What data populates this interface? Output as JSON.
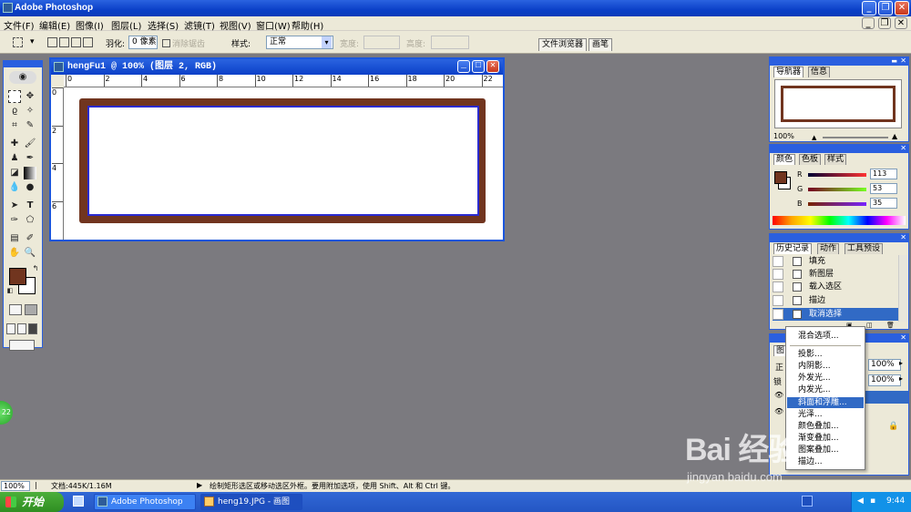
{
  "app": {
    "title": "Adobe Photoshop"
  },
  "menu": [
    "文件(F)",
    "编辑(E)",
    "图像(I)",
    "图层(L)",
    "选择(S)",
    "滤镜(T)",
    "视图(V)",
    "窗口(W)",
    "帮助(H)"
  ],
  "options": {
    "feather_label": "羽化:",
    "feather_value": "0 像素",
    "antialias_label": "消除锯齿",
    "style_label": "样式:",
    "style_value": "正常",
    "width_label": "宽度:",
    "height_label": "高度:",
    "dock_tabs": [
      "文件浏览器",
      "画笔"
    ]
  },
  "document": {
    "title": "hengFu1 @ 100% (图层 2, RGB)",
    "ruler_h": [
      "0",
      "2",
      "4",
      "6",
      "8",
      "10",
      "12",
      "14",
      "16",
      "18",
      "20",
      "22"
    ],
    "ruler_v": [
      "0",
      "2",
      "4",
      "6"
    ]
  },
  "navigator": {
    "tabs": [
      "导航器",
      "信息"
    ],
    "zoom": "100%"
  },
  "color": {
    "tabs": [
      "颜色",
      "色板",
      "样式"
    ],
    "fg_hex": "#71351f",
    "r_label": "R",
    "r": "113",
    "g_label": "G",
    "g": "53",
    "b_label": "B",
    "b": "35"
  },
  "history": {
    "tabs": [
      "历史记录",
      "动作",
      "工具预设"
    ],
    "items": [
      "填充",
      "新图层",
      "载入选区",
      "描边",
      "取消选择"
    ]
  },
  "layers": {
    "tab": "图",
    "mode_visible": "正",
    "opacity": "100%",
    "fill": "100%",
    "lock_visible": "锁"
  },
  "context_menu": {
    "items": [
      "混合选项...",
      "投影...",
      "内阴影...",
      "外发光...",
      "内发光...",
      "斜面和浮雕...",
      "光泽...",
      "颜色叠加...",
      "渐变叠加...",
      "图案叠加...",
      "描边..."
    ],
    "highlighted": "斜面和浮雕..."
  },
  "status": {
    "zoom": "100%",
    "doc_info": "文档:445K/1.16M",
    "hint": "绘制矩形选区或移动选区外框。要用附加选项，使用 Shift、Alt 和 Ctrl 键。"
  },
  "taskbar": {
    "start": "开始",
    "buttons": [
      "Adobe Photoshop",
      "heng19.JPG - 画图"
    ],
    "clock": "9:44"
  },
  "watermark": {
    "brand": "Bai 经验",
    "sub": "jingyan.baidu.com"
  },
  "side_badge": "22"
}
